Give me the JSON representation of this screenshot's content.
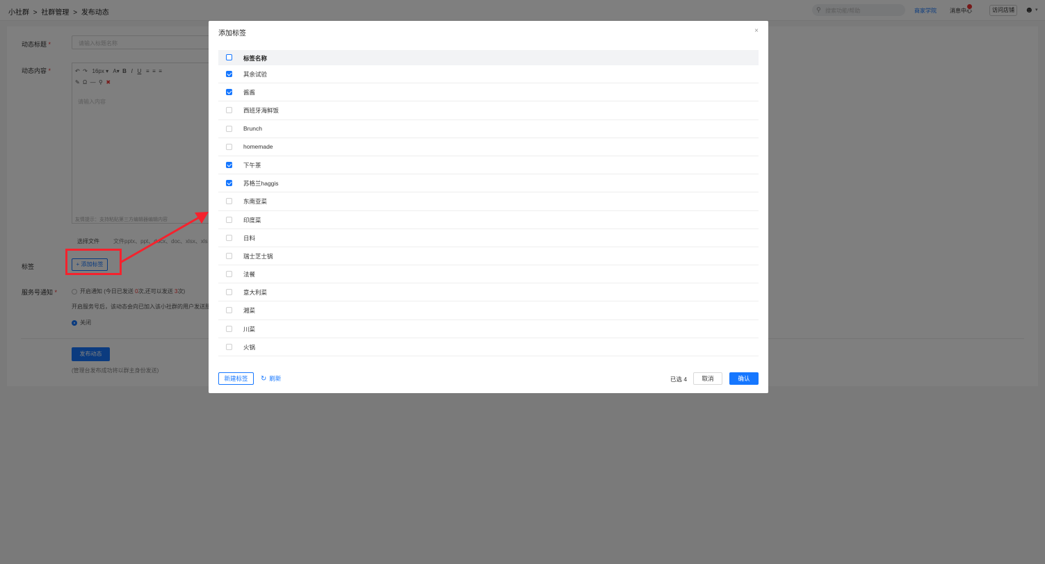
{
  "breadcrumb": [
    "小社群",
    ">",
    "社群管理",
    ">",
    "发布动态"
  ],
  "topbar": {
    "search_placeholder": "搜索功能/帮助",
    "link_blue": "商家学院",
    "link_msg": "消息中心",
    "btn_visit": "访问店铺"
  },
  "form": {
    "title_label": "动态标题",
    "title_placeholder": "请输入标题名称",
    "content_label": "动态内容",
    "font_size": "16px",
    "content_placeholder": "请输入内容",
    "editor_tip": "友情提示：支持粘贴第三方编辑器编辑内容",
    "upload_button": "选择文件",
    "upload_tip": "文件pptx、ppt、docx、doc、xlsx、xls",
    "tag_label": "标签",
    "add_tag_button": "+ 添加标签",
    "notify_label": "服务号通知",
    "notify_on_a": "开启通知 (今日已发送 ",
    "notify_on_b": "0",
    "notify_on_c": "次,还可以发送 ",
    "notify_on_d": "3",
    "notify_on_e": "次)",
    "notify_desc": "开启服务号后，该动态会向已加入该小社群的用户发送服务号通知",
    "notify_off": "关闭",
    "publish_button": "发布动态",
    "publish_note": "(管理台发布成功将以群主身份发送)"
  },
  "dialog": {
    "title": "添加标签",
    "close": "×",
    "column_header": "标签名称",
    "tags": [
      {
        "name": "其余试验",
        "checked": true
      },
      {
        "name": "酱酱",
        "checked": true
      },
      {
        "name": "西班牙海鲜饭",
        "checked": false
      },
      {
        "name": "Brunch",
        "checked": false
      },
      {
        "name": "homemade",
        "checked": false
      },
      {
        "name": "下午茶",
        "checked": true
      },
      {
        "name": "苏格兰haggis",
        "checked": true
      },
      {
        "name": "东南亚菜",
        "checked": false
      },
      {
        "name": "印度菜",
        "checked": false
      },
      {
        "name": "日料",
        "checked": false
      },
      {
        "name": "瑞士芝士锅",
        "checked": false
      },
      {
        "name": "法餐",
        "checked": false
      },
      {
        "name": "意大利菜",
        "checked": false
      },
      {
        "name": "湘菜",
        "checked": false
      },
      {
        "name": "川菜",
        "checked": false
      },
      {
        "name": "火锅",
        "checked": false
      }
    ],
    "new_tag_button": "新建标签",
    "refresh_button": "刷新",
    "selected_count": "已选 4",
    "cancel_button": "取消",
    "confirm_button": "确认"
  }
}
